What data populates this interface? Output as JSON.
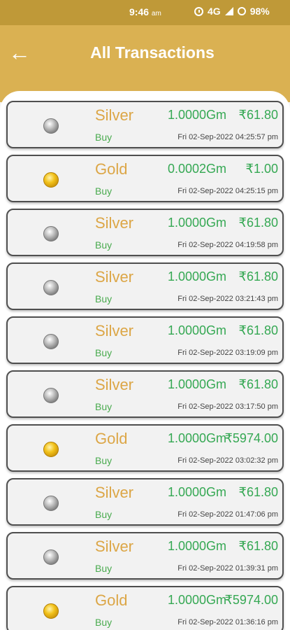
{
  "status_bar": {
    "time": "9:46",
    "ampm": "am",
    "network": "4G",
    "battery": "98%"
  },
  "header": {
    "back_icon": "←",
    "title": "All Transactions"
  },
  "transactions": [
    {
      "metal": "Silver",
      "coin_icon": "silver-coin-icon",
      "amount": "1.0000Gm",
      "price": "₹61.80",
      "type": "Buy",
      "date": "Fri 02-Sep-2022 04:25:57 pm"
    },
    {
      "metal": "Gold",
      "coin_icon": "gold-coin-icon",
      "amount": "0.0002Gm",
      "price": "₹1.00",
      "type": "Buy",
      "date": "Fri 02-Sep-2022 04:25:15 pm"
    },
    {
      "metal": "Silver",
      "coin_icon": "silver-coin-icon",
      "amount": "1.0000Gm",
      "price": "₹61.80",
      "type": "Buy",
      "date": "Fri 02-Sep-2022 04:19:58 pm"
    },
    {
      "metal": "Silver",
      "coin_icon": "silver-coin-icon",
      "amount": "1.0000Gm",
      "price": "₹61.80",
      "type": "Buy",
      "date": "Fri 02-Sep-2022 03:21:43 pm"
    },
    {
      "metal": "Silver",
      "coin_icon": "silver-coin-icon",
      "amount": "1.0000Gm",
      "price": "₹61.80",
      "type": "Buy",
      "date": "Fri 02-Sep-2022 03:19:09 pm"
    },
    {
      "metal": "Silver",
      "coin_icon": "silver-coin-icon",
      "amount": "1.0000Gm",
      "price": "₹61.80",
      "type": "Buy",
      "date": "Fri 02-Sep-2022 03:17:50 pm"
    },
    {
      "metal": "Gold",
      "coin_icon": "gold-coin-icon",
      "amount": "1.0000Gm",
      "price": "₹5974.00",
      "type": "Buy",
      "date": "Fri 02-Sep-2022 03:02:32 pm"
    },
    {
      "metal": "Silver",
      "coin_icon": "silver-coin-icon",
      "amount": "1.0000Gm",
      "price": "₹61.80",
      "type": "Buy",
      "date": "Fri 02-Sep-2022 01:47:06 pm"
    },
    {
      "metal": "Silver",
      "coin_icon": "silver-coin-icon",
      "amount": "1.0000Gm",
      "price": "₹61.80",
      "type": "Buy",
      "date": "Fri 02-Sep-2022 01:39:31 pm"
    },
    {
      "metal": "Gold",
      "coin_icon": "gold-coin-icon",
      "amount": "1.0000Gm",
      "price": "₹5974.00",
      "type": "Buy",
      "date": "Fri 02-Sep-2022 01:36:16 pm"
    }
  ]
}
